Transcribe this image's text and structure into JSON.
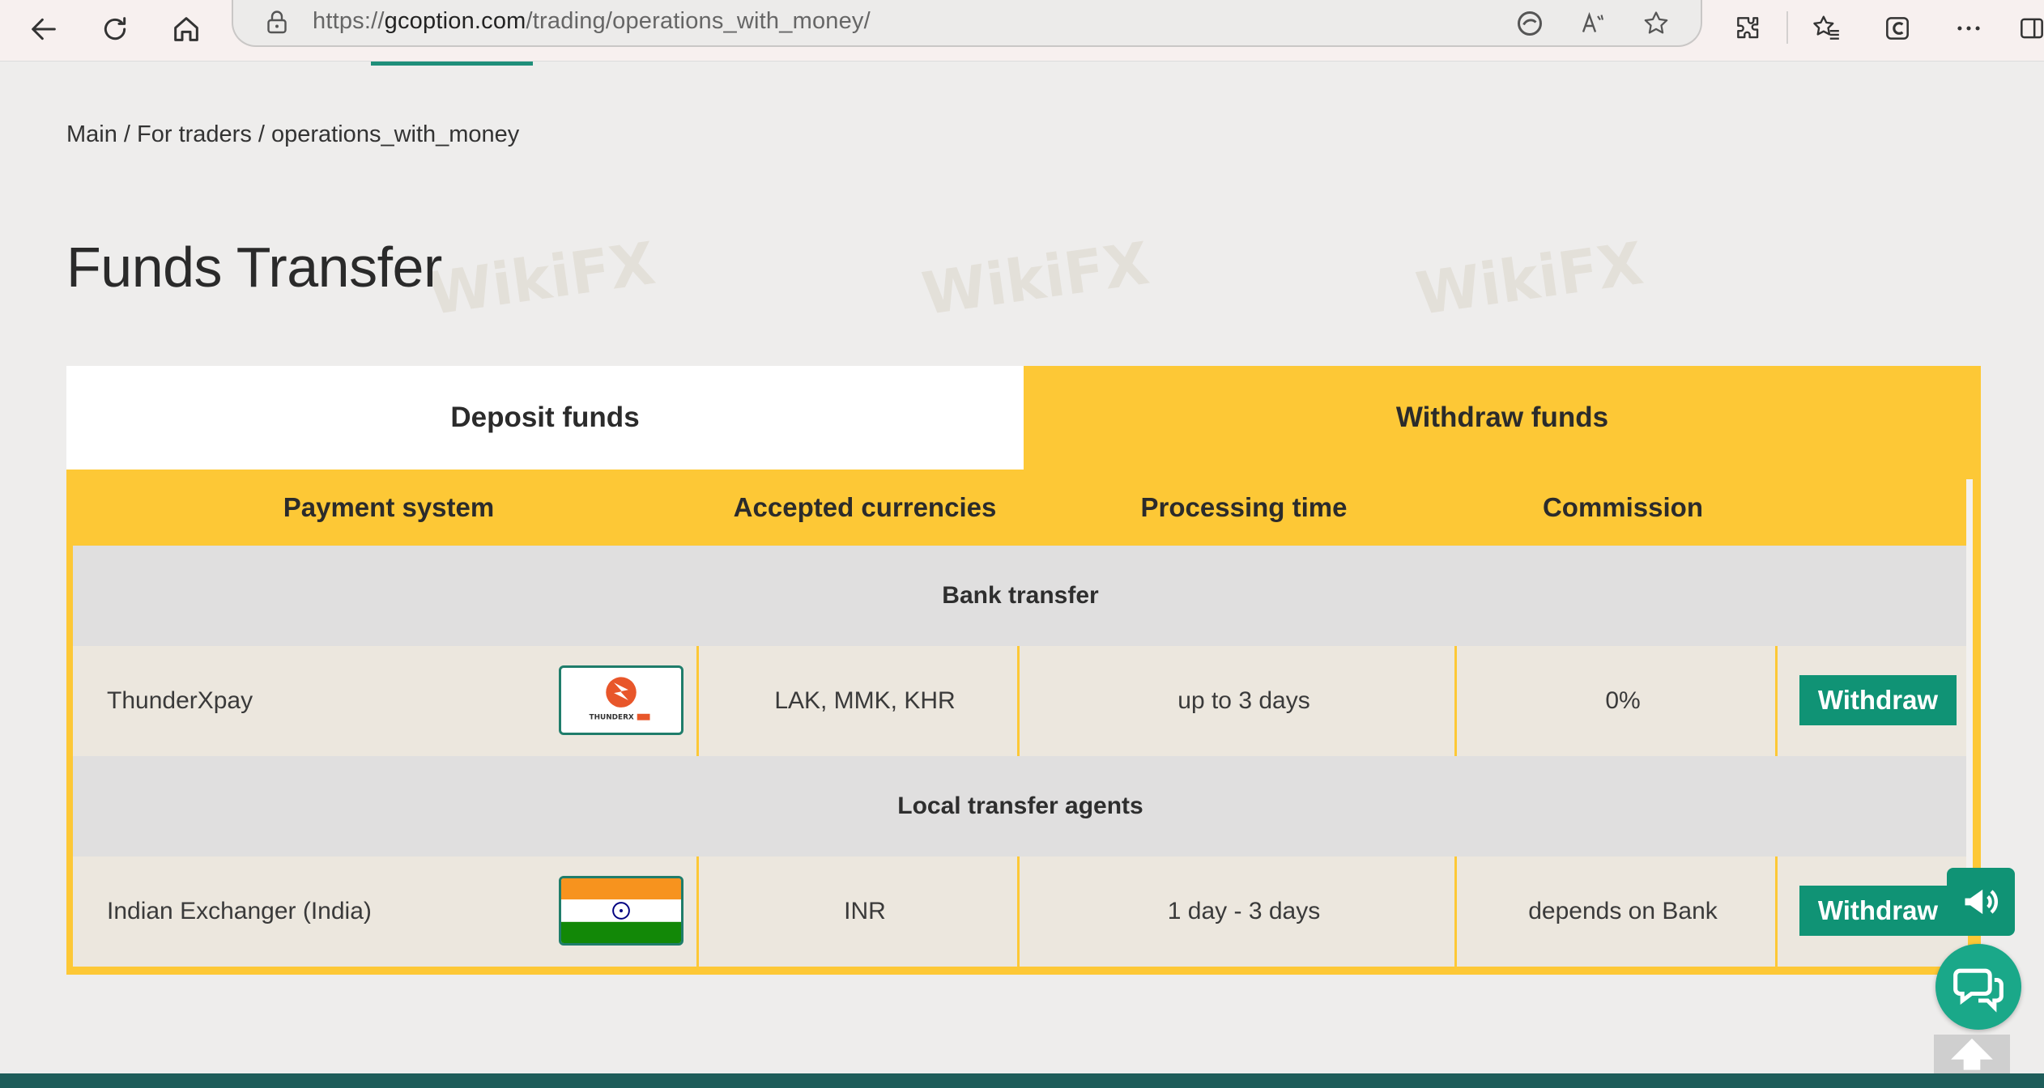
{
  "browser": {
    "url_prefix": "https://",
    "url_host": "gcoption.com",
    "url_path": "/trading/operations_with_money/",
    "icons": [
      "back-icon",
      "refresh-icon",
      "home-icon",
      "lock-icon",
      "tracking-prevention-icon",
      "read-aloud-icon",
      "favorite-star-icon",
      "extensions-icon",
      "favorites-icon",
      "collections-icon",
      "more-icon"
    ]
  },
  "breadcrumb": "Main / For traders / operations_with_money",
  "title": "Funds Transfer",
  "tabs": {
    "deposit": "Deposit funds",
    "withdraw": "Withdraw funds"
  },
  "table": {
    "headers": [
      "Payment system",
      "Accepted currencies",
      "Processing time",
      "Commission"
    ],
    "groups": [
      {
        "name": "Bank transfer",
        "rows": [
          {
            "payment_system": "ThunderXpay",
            "logo": "thunderxpay-logo",
            "currencies": "LAK, MMK, KHR",
            "processing_time": "up to 3 days",
            "commission": "0%",
            "action": "Withdraw"
          }
        ]
      },
      {
        "name": "Local transfer agents",
        "rows": [
          {
            "payment_system": "Indian Exchanger (India)",
            "logo": "india-flag",
            "currencies": "INR",
            "processing_time": "1 day - 3 days",
            "commission": "depends on Bank",
            "action": "Withdraw"
          }
        ]
      }
    ]
  },
  "logo_text": "THUNDERX",
  "watermark": "WikiFX",
  "colors": {
    "accent_yellow": "#fdc836",
    "button_green": "#109375",
    "tab_indicator": "#1f8f7a"
  }
}
